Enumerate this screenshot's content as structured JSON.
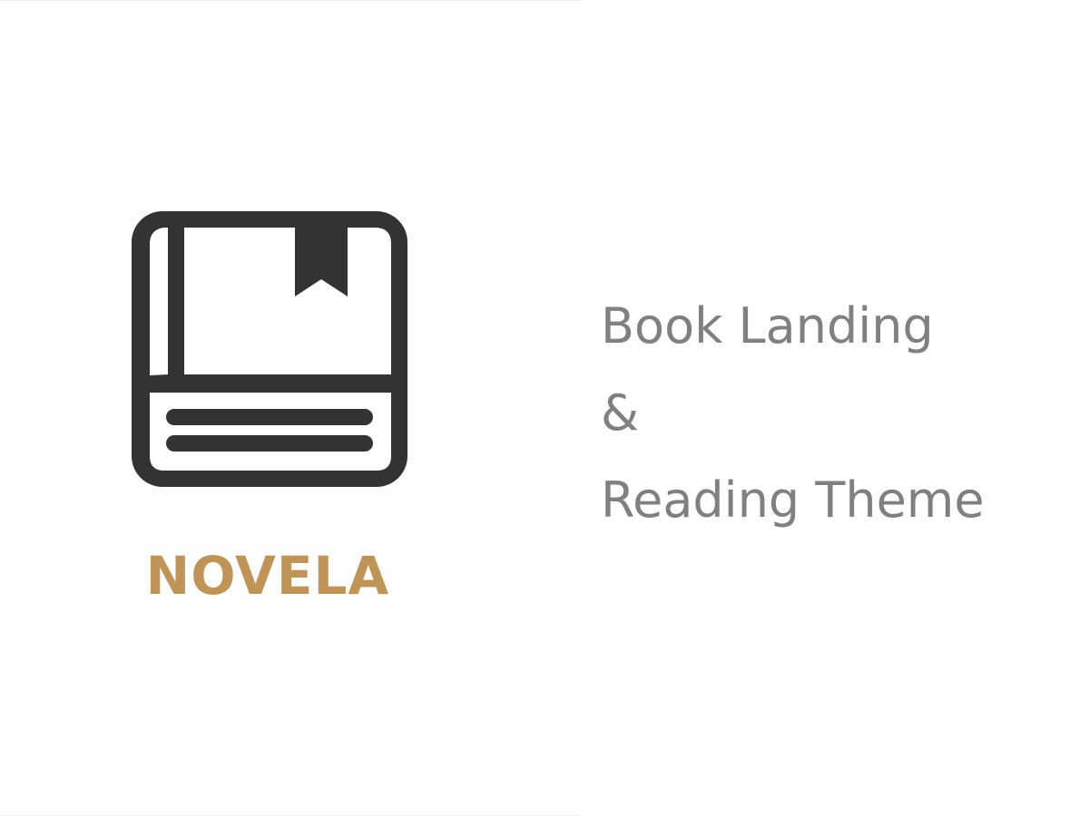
{
  "brand": {
    "name": "NOVELA",
    "color": "#c09457",
    "icon": "book-with-bookmark-icon"
  },
  "tagline": {
    "lines": [
      "Book Landing",
      "&",
      "Reading Theme"
    ],
    "color": "#808080"
  },
  "icon_color": "#333333"
}
